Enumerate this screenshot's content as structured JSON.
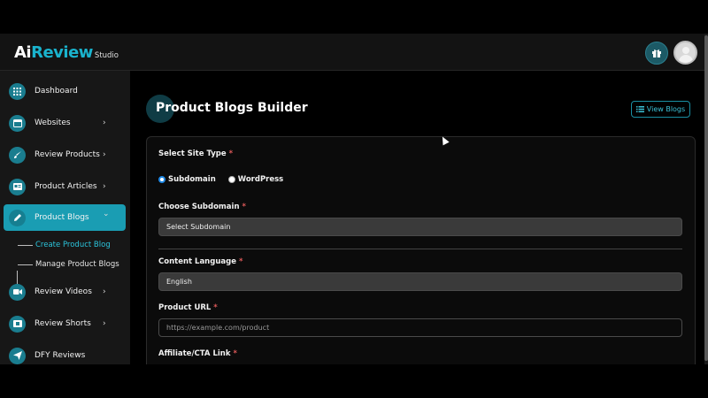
{
  "header": {
    "logo_ai": "Ai",
    "logo_review": "Review",
    "logo_studio": "Studio"
  },
  "sidebar": {
    "items": [
      {
        "label": "Dashboard",
        "icon": "grid-icon",
        "chevron": ""
      },
      {
        "label": "Websites",
        "icon": "window-icon",
        "chevron": "›"
      },
      {
        "label": "Review Products",
        "icon": "brush-icon",
        "chevron": "›"
      },
      {
        "label": "Product Articles",
        "icon": "article-icon",
        "chevron": "›"
      },
      {
        "label": "Product Blogs",
        "icon": "pencil-icon",
        "chevron": "⌄",
        "active": true
      },
      {
        "label": "Review Videos",
        "icon": "video-icon",
        "chevron": "›"
      },
      {
        "label": "Review Shorts",
        "icon": "film-icon",
        "chevron": "›"
      },
      {
        "label": "DFY Reviews",
        "icon": "send-icon",
        "chevron": ""
      }
    ],
    "subitems": [
      {
        "label": "Create Product Blog",
        "active": true
      },
      {
        "label": "Manage Product Blogs",
        "active": false
      }
    ]
  },
  "main": {
    "title": "Product Blogs Builder",
    "view_blogs_label": "View Blogs",
    "form": {
      "site_type_label": "Select Site Type",
      "site_type_options": [
        "Subdomain",
        "WordPress"
      ],
      "site_type_selected": "Subdomain",
      "subdomain_label": "Choose Subdomain",
      "subdomain_value": "Select Subdomain",
      "language_label": "Content Language",
      "language_value": "English",
      "product_url_label": "Product URL",
      "product_url_placeholder": "https://example.com/product",
      "affiliate_label": "Affiliate/CTA Link",
      "required_mark": "*"
    }
  },
  "colors": {
    "accent": "#1a9db3",
    "brand": "#1ab3cd",
    "required": "#e05a5a"
  }
}
